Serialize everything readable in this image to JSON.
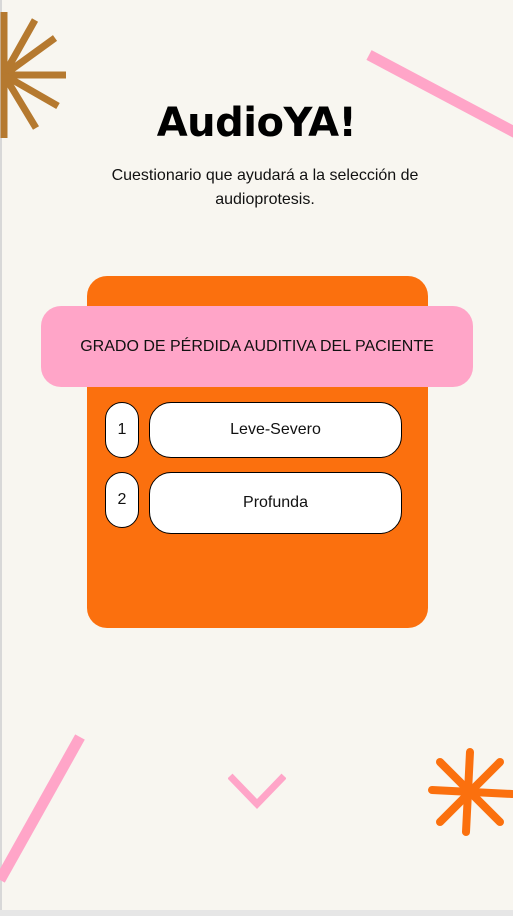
{
  "app": {
    "title": "AudioYA!",
    "subtitle": "Cuestionario que ayudará a la selección de audioprotesis."
  },
  "question": {
    "text": "GRADO DE PÉRDIDA AUDITIVA DEL PACIENTE",
    "options": [
      {
        "number": "1",
        "label": "Leve-Severo"
      },
      {
        "number": "2",
        "label": "Profunda"
      }
    ]
  },
  "navigation": {
    "next_icon": "chevron-down-icon"
  },
  "colors": {
    "background": "#f8f6f0",
    "card": "#fb700e",
    "banner": "#ffa5c8",
    "starburst": "#b5792f",
    "asterisk": "#fb700e",
    "pink_line": "#ffa5c8"
  }
}
